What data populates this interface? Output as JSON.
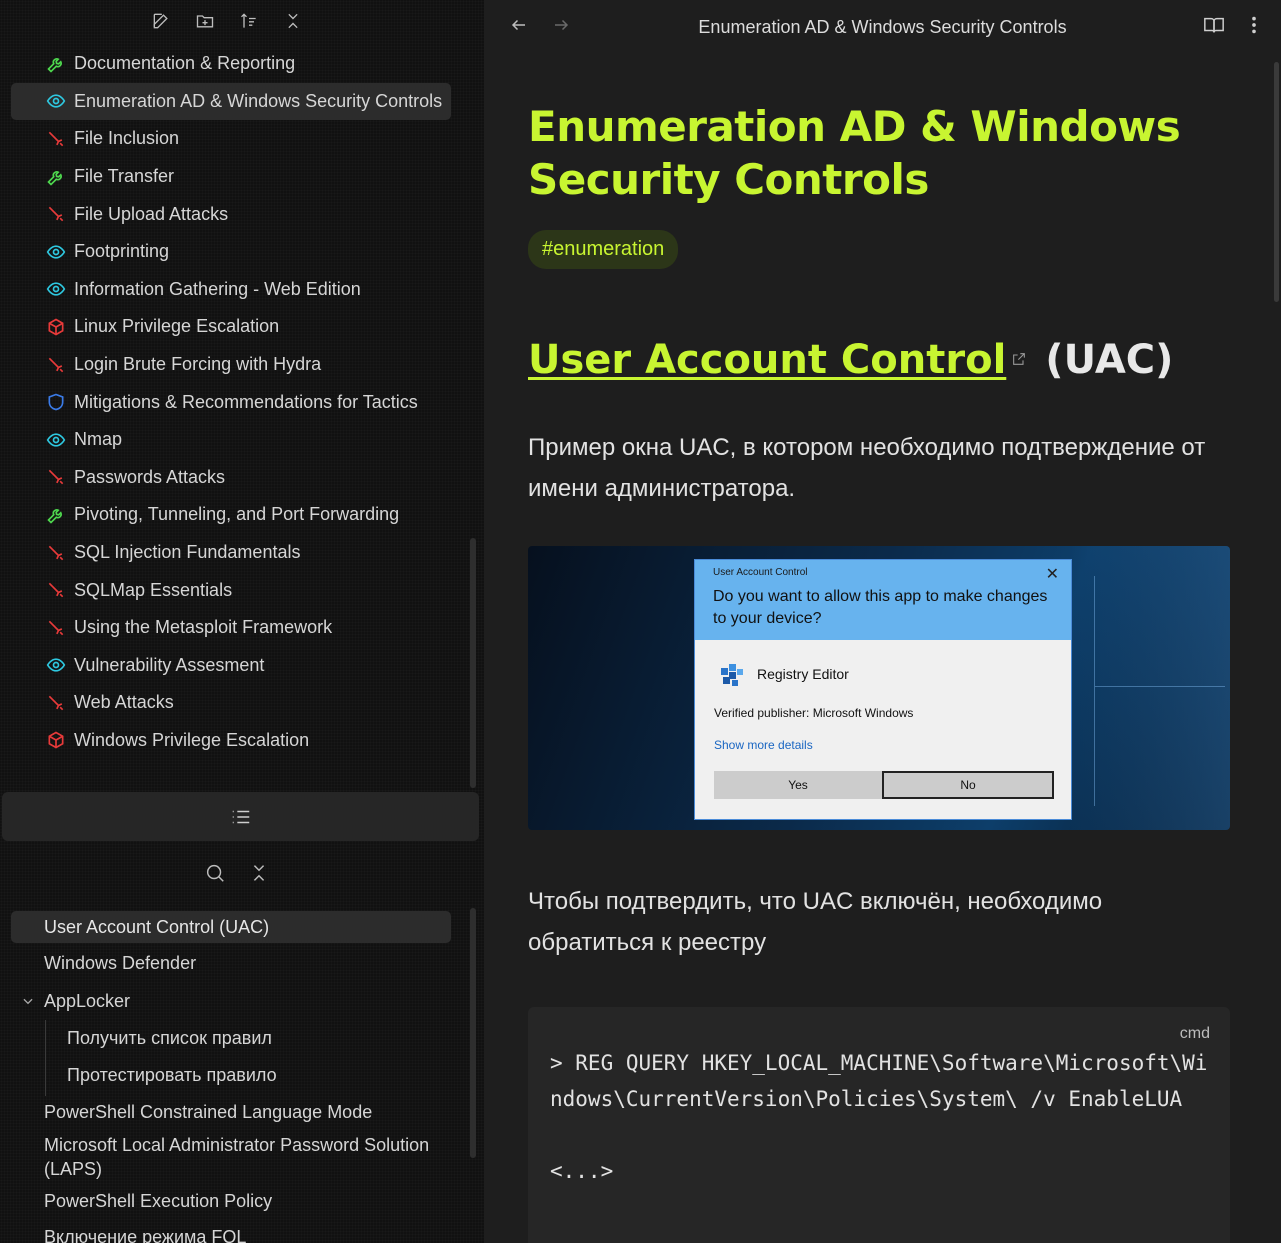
{
  "sidebar": {
    "files": [
      {
        "label": "Documentation & Reporting",
        "icon": "wrench-icon",
        "color": "#4ed84e"
      },
      {
        "label": "Enumeration AD & Windows Security Controls",
        "icon": "eye-icon",
        "color": "#2ec8e0",
        "active": true
      },
      {
        "label": "File Inclusion",
        "icon": "sword-icon",
        "color": "#e83a3a"
      },
      {
        "label": "File Transfer",
        "icon": "wrench-icon",
        "color": "#4ed84e"
      },
      {
        "label": "File Upload Attacks",
        "icon": "sword-icon",
        "color": "#e83a3a"
      },
      {
        "label": "Footprinting",
        "icon": "eye-icon",
        "color": "#2ec8e0"
      },
      {
        "label": "Information Gathering - Web Edition",
        "icon": "eye-icon",
        "color": "#2ec8e0"
      },
      {
        "label": "Linux Privilege Escalation",
        "icon": "cube-icon",
        "color": "#e83a3a"
      },
      {
        "label": "Login Brute Forcing with Hydra",
        "icon": "sword-icon",
        "color": "#e83a3a"
      },
      {
        "label": "Mitigations & Recommendations for Tactics",
        "icon": "shield-icon",
        "color": "#3a7be8"
      },
      {
        "label": "Nmap",
        "icon": "eye-icon",
        "color": "#2ec8e0"
      },
      {
        "label": "Passwords Attacks",
        "icon": "sword-icon",
        "color": "#e83a3a"
      },
      {
        "label": "Pivoting, Tunneling, and Port Forwarding",
        "icon": "wrench-icon",
        "color": "#4ed84e"
      },
      {
        "label": "SQL Injection Fundamentals",
        "icon": "sword-icon",
        "color": "#e83a3a"
      },
      {
        "label": "SQLMap Essentials",
        "icon": "sword-icon",
        "color": "#e83a3a"
      },
      {
        "label": "Using the Metasploit Framework",
        "icon": "sword-icon",
        "color": "#e83a3a"
      },
      {
        "label": "Vulnerability Assesment",
        "icon": "eye-icon",
        "color": "#2ec8e0"
      },
      {
        "label": "Web Attacks",
        "icon": "sword-icon",
        "color": "#e83a3a"
      },
      {
        "label": "Windows Privilege Escalation",
        "icon": "cube-icon",
        "color": "#e83a3a"
      }
    ]
  },
  "outline": {
    "items": [
      {
        "label": "User Account Control (UAC)"
      },
      {
        "label": "Windows Defender"
      },
      {
        "label": "AppLocker"
      },
      {
        "label": "Получить список правил"
      },
      {
        "label": "Протестировать правило"
      },
      {
        "label": "PowerShell Constrained Language Mode"
      },
      {
        "label": "Microsoft Local Administrator Password Solution (LAPS)"
      },
      {
        "label": "PowerShell Execution Policy"
      },
      {
        "label": "Включение режима FQL"
      }
    ]
  },
  "header": {
    "title": "Enumeration AD & Windows Security Controls"
  },
  "doc": {
    "title": "Enumeration AD & Windows Security Controls",
    "tag": "#enumeration",
    "h2_link": "User Account Control",
    "h2_rest": "(UAC)",
    "p1": "Пример окна UAC, в котором необходимо подтверждение от имени администратора.",
    "p2": "Чтобы подтвердить, что UAC включён, необходимо обратиться к реестру",
    "code_lang": "cmd",
    "code": "> REG QUERY HKEY_LOCAL_MACHINE\\Software\\Microsoft\\Windows\\CurrentVersion\\Policies\\System\\ /v EnableLUA\n\n<...>"
  },
  "uac_dialog": {
    "caption": "User Account Control",
    "question": "Do you want to allow this app to make changes to your device?",
    "app": "Registry Editor",
    "publisher": "Verified publisher: Microsoft Windows",
    "more": "Show more details",
    "yes": "Yes",
    "no": "No"
  },
  "colors": {
    "accent": "#c8f531"
  }
}
